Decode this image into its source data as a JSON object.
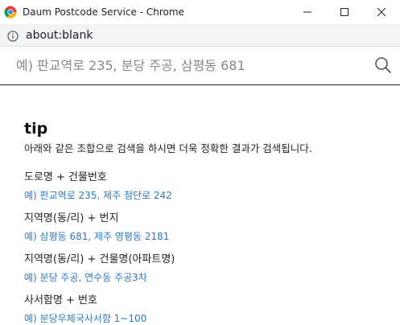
{
  "window": {
    "title": "Daum Postcode Service - Chrome",
    "address": "about:blank"
  },
  "search": {
    "placeholder": "예) 판교역로 235, 분당 주공, 삼평동 681"
  },
  "tip": {
    "title": "tip",
    "description": "아래와 같은 조합으로 검색을 하시면 더욱 정확한 결과가 검색됩니다.",
    "items": [
      {
        "label": "도로명 + 건물번호",
        "example": "예) 판교역로 235,  제주 첨단로 242"
      },
      {
        "label": "지역명(동/리) + 번지",
        "example": "예) 삼평동 681,  제주 영평동 2181"
      },
      {
        "label": "지역명(동/리) + 건물명(아파트명)",
        "example": "예) 분당 주공,  연수동 주공3차"
      },
      {
        "label": "사서함명 + 번호",
        "example": "예) 분당우체국사서함 1~100"
      }
    ]
  },
  "colors": {
    "example_link": "#2b7ac4",
    "search_underline": "#222222"
  }
}
